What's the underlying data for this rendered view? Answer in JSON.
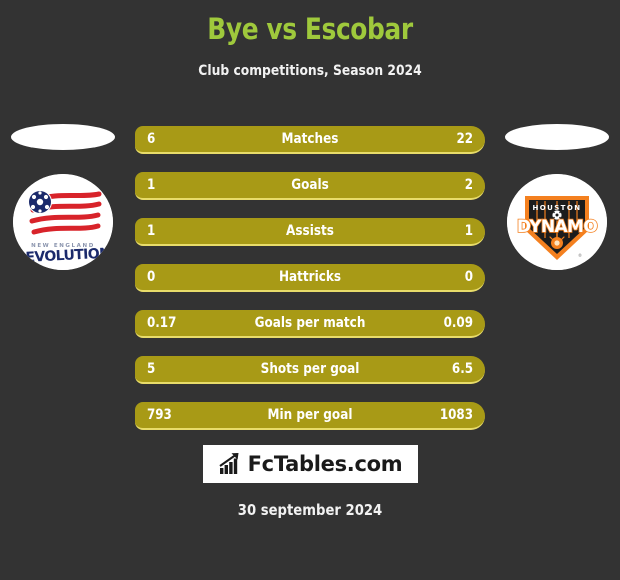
{
  "header": {
    "title": "Bye vs Escobar",
    "subtitle": "Club competitions, Season 2024",
    "title_color": "#9fc93c"
  },
  "teams": {
    "home": {
      "name": "New England Revolution",
      "logo_icon": "new-england-revolution-logo"
    },
    "away": {
      "name": "Houston Dynamo",
      "logo_icon": "houston-dynamo-logo"
    }
  },
  "stats": [
    {
      "label": "Matches",
      "home": "6",
      "away": "22"
    },
    {
      "label": "Goals",
      "home": "1",
      "away": "2"
    },
    {
      "label": "Assists",
      "home": "1",
      "away": "1"
    },
    {
      "label": "Hattricks",
      "home": "0",
      "away": "0"
    },
    {
      "label": "Goals per match",
      "home": "0.17",
      "away": "0.09"
    },
    {
      "label": "Shots per goal",
      "home": "5",
      "away": "6.5"
    },
    {
      "label": "Min per goal",
      "home": "793",
      "away": "1083"
    }
  ],
  "brand": {
    "text": "FcTables.com",
    "icon": "bar-chart-growth-icon"
  },
  "footer": {
    "date": "30 september 2024"
  },
  "colors": {
    "background": "#333333",
    "bar_fill": "#a89a16",
    "bar_border": "#e8dc6a",
    "text": "#ffffff"
  }
}
